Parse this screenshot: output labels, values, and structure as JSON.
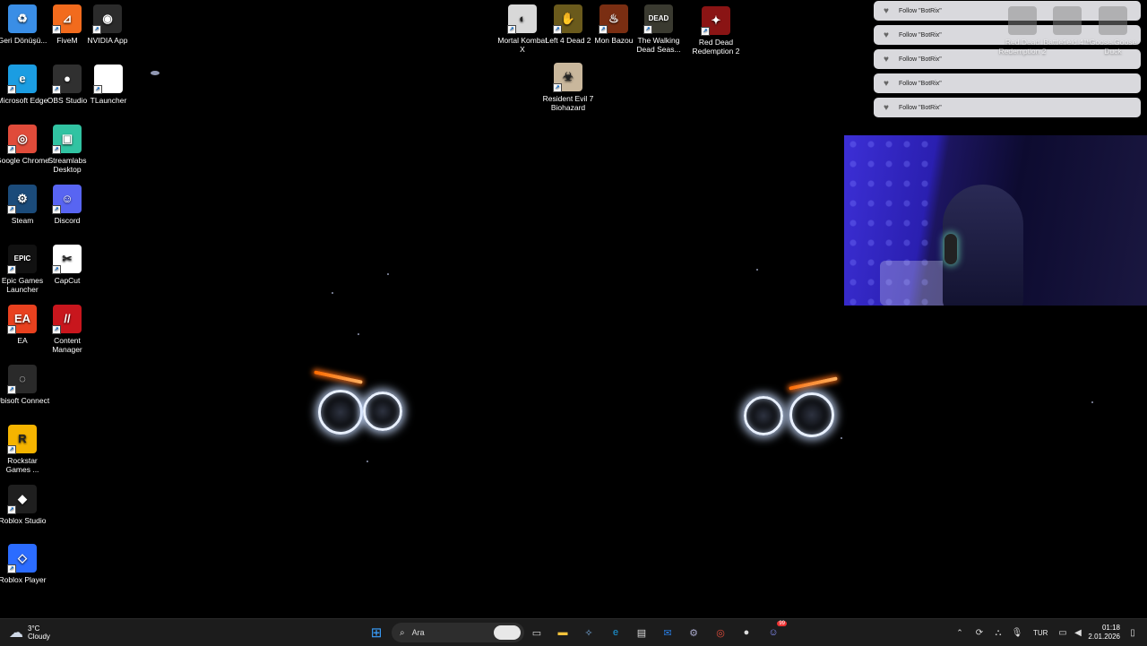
{
  "desktop": {
    "left_icons": [
      {
        "name": "recycle-bin-icon",
        "label": "Geri Dönüşü...",
        "color": "#3a8ee6",
        "glyph": "♻"
      },
      {
        "name": "fivem-icon",
        "label": "FiveM",
        "color": "#f26b1d",
        "glyph": "⊿"
      },
      {
        "name": "nvidia-icon",
        "label": "NVIDIA App",
        "color": "#2b2b2b",
        "glyph": "◉"
      },
      {
        "name": "edge-icon",
        "label": "Microsoft Edge",
        "color": "#1b9de2",
        "glyph": "e"
      },
      {
        "name": "obs-icon",
        "label": "OBS Studio",
        "color": "#303030",
        "glyph": "●"
      },
      {
        "name": "tlauncher-icon",
        "label": "TLauncher",
        "color": "#ffffff",
        "glyph": ""
      },
      {
        "name": "chrome-icon",
        "label": "Google Chrome",
        "color": "#e04b3a",
        "glyph": "◎"
      },
      {
        "name": "streamlabs-icon",
        "label": "Streamlabs Desktop",
        "color": "#31c3a2",
        "glyph": "▣"
      },
      {
        "name": "steam-icon",
        "label": "Steam",
        "color": "#1b4b7a",
        "glyph": "⚙"
      },
      {
        "name": "discord-icon",
        "label": "Discord",
        "color": "#5865f2",
        "glyph": "☺"
      },
      {
        "name": "epic-icon",
        "label": "Epic Games Launcher",
        "color": "#111111",
        "glyph": "EPIC"
      },
      {
        "name": "capcut-icon",
        "label": "CapCut",
        "color": "#ffffff",
        "glyph": "✂"
      },
      {
        "name": "ea-icon",
        "label": "EA",
        "color": "#e8411f",
        "glyph": "EA"
      },
      {
        "name": "content-manager-icon",
        "label": "Content Manager",
        "color": "#c8161d",
        "glyph": "//"
      },
      {
        "name": "ubisoft-icon",
        "label": "Ubisoft Connect",
        "color": "#2a2a2a",
        "glyph": "◌"
      },
      {
        "name": "rockstar-icon",
        "label": "Rockstar Games ...",
        "color": "#f5b400",
        "glyph": "R"
      },
      {
        "name": "roblox-studio-icon",
        "label": "Roblox Studio",
        "color": "#1f1f1f",
        "glyph": "◆"
      },
      {
        "name": "roblox-player-icon",
        "label": "Roblox Player",
        "color": "#2b6cff",
        "glyph": "◇"
      }
    ],
    "top_icons": [
      {
        "name": "mortal-kombat-icon",
        "label": "Mortal Kombat X",
        "color": "#d8d8d8",
        "glyph": "◐"
      },
      {
        "name": "left4dead-icon",
        "label": "Left 4 Dead 2",
        "color": "#6a5a1c",
        "glyph": "✋"
      },
      {
        "name": "mon-bazou-icon",
        "label": "Mon Bazou",
        "color": "#7a2e12",
        "glyph": "♨"
      },
      {
        "name": "walking-dead-icon",
        "label": "The Walking Dead Seas...",
        "color": "#3a3a30",
        "glyph": "DEAD"
      },
      {
        "name": "rdr2-icon",
        "label": "Red Dead Redemption 2",
        "color": "#8a1414",
        "glyph": "✦"
      },
      {
        "name": "resident-evil-icon",
        "label": "Resident Evil 7 Biohazard",
        "color": "#c9b79c",
        "glyph": "☣"
      }
    ],
    "faded_icons": [
      {
        "name": "rdr2-faded-icon",
        "label": "Red Dead Redemption 2"
      },
      {
        "name": "battlefield-faded-icon",
        "label": "Battlefield 4™"
      },
      {
        "name": "goose-faded-icon",
        "label": "Goose Goose Duck"
      }
    ]
  },
  "overlay": {
    "alerts": [
      {
        "text": "Follow \"BotRix\""
      },
      {
        "text": "Follow \"BotRix\""
      },
      {
        "text": "Follow \"BotRix\""
      },
      {
        "text": "Follow \"BotRix\""
      },
      {
        "text": "Follow \"BotRix\""
      }
    ]
  },
  "taskbar": {
    "weather_temp": "3°C",
    "weather_desc": "Cloudy",
    "search_placeholder": "Ara",
    "language": "TUR",
    "time": "01:18",
    "date": "2.01.2026",
    "discord_badge": "99"
  }
}
